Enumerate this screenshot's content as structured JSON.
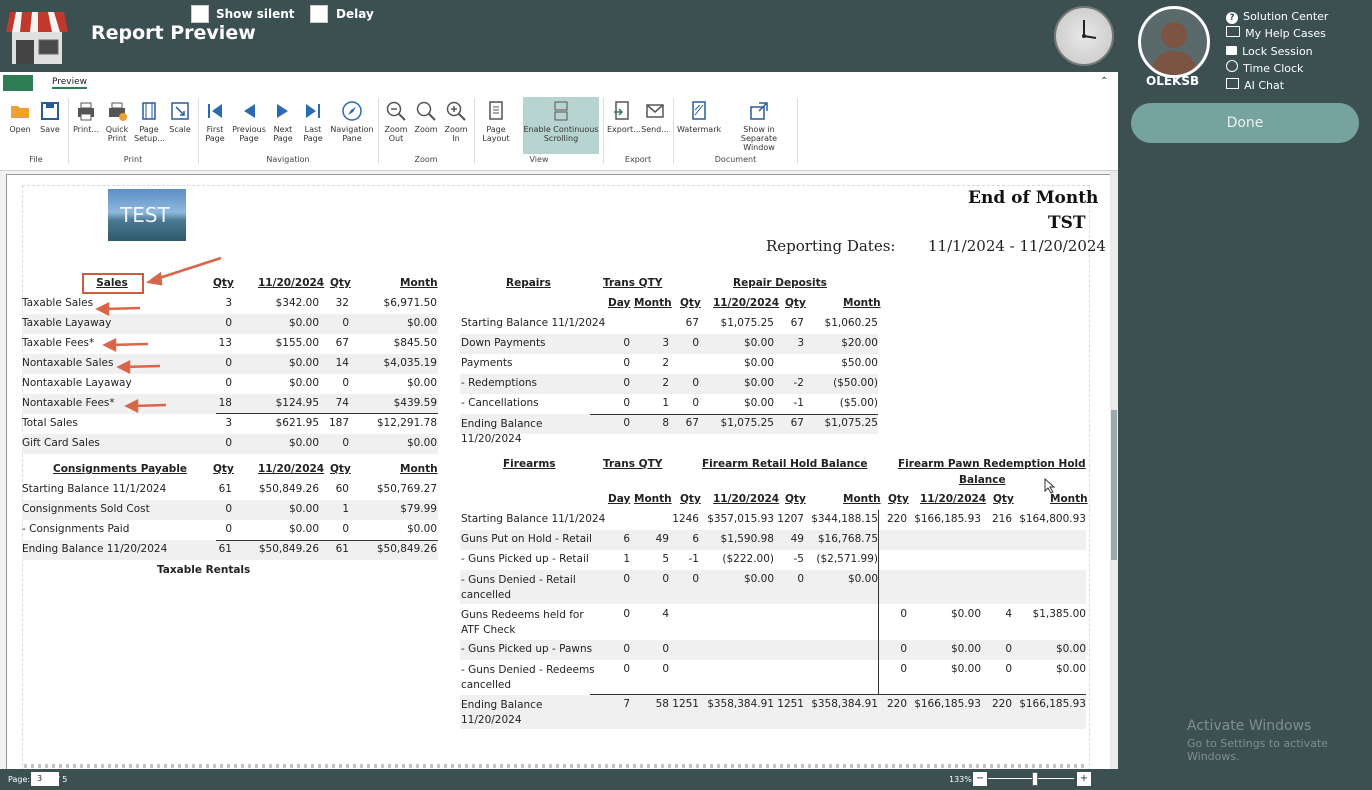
{
  "header": {
    "title": "Report Preview",
    "show_silent": "Show silent",
    "delay": "Delay"
  },
  "right_panel": {
    "links": [
      "Solution Center",
      "My Help Cases",
      "Lock Session",
      "Time Clock",
      "AI Chat"
    ],
    "username": "OLEKSB",
    "done": "Done",
    "activate_title": "Activate Windows",
    "activate_sub": "Go to Settings to activate Windows."
  },
  "ribbon": {
    "tab": "Preview",
    "buttons": {
      "open": "Open",
      "save": "Save",
      "print": "Print...",
      "quick_print": "Quick Print",
      "page_setup": "Page Setup...",
      "scale": "Scale",
      "first_page": "First Page",
      "previous_page": "Previous Page",
      "next_page": "Next Page",
      "last_page": "Last Page",
      "navigation_pane": "Navigation Pane",
      "zoom_out": "Zoom Out",
      "zoom": "Zoom",
      "zoom_in": "Zoom In",
      "page_layout": "Page Layout",
      "continuous": "Enable Continuous Scrolling",
      "export": "Export...",
      "send": "Send...",
      "watermark": "Watermark",
      "separate_window": "Show in Separate Window"
    },
    "groups": {
      "file": "File",
      "print": "Print",
      "navigation": "Navigation",
      "zoom": "Zoom",
      "view": "View",
      "export": "Export",
      "document": "Document"
    }
  },
  "statusbar": {
    "page_label": "Page:",
    "page": "3",
    "of": "/ 5",
    "zoom": "133%"
  },
  "report": {
    "logo_text": "TEST",
    "title": "End of Month",
    "store": "TST",
    "reporting_label": "Reporting Dates:",
    "reporting_range": "11/1/2024 - 11/20/2024",
    "sales": {
      "headers": [
        "Sales",
        "Qty",
        "11/20/2024",
        "Qty",
        "Month"
      ],
      "rows": [
        [
          "Taxable Sales",
          "3",
          "$342.00",
          "32",
          "$6,971.50"
        ],
        [
          "Taxable Layaway",
          "0",
          "$0.00",
          "0",
          "$0.00"
        ],
        [
          "Taxable Fees*",
          "13",
          "$155.00",
          "67",
          "$845.50"
        ],
        [
          "Nontaxable Sales",
          "0",
          "$0.00",
          "14",
          "$4,035.19"
        ],
        [
          "Nontaxable Layaway",
          "0",
          "$0.00",
          "0",
          "$0.00"
        ],
        [
          "Nontaxable Fees*",
          "18",
          "$124.95",
          "74",
          "$439.59"
        ],
        [
          "Total Sales",
          "3",
          "$621.95",
          "187",
          "$12,291.78"
        ],
        [
          "Gift Card Sales",
          "0",
          "$0.00",
          "0",
          "$0.00"
        ]
      ]
    },
    "consignments": {
      "headers": [
        "Consignments Payable",
        "Qty",
        "11/20/2024",
        "Qty",
        "Month"
      ],
      "rows": [
        [
          "Starting Balance 11/1/2024",
          "61",
          "$50,849.26",
          "60",
          "$50,769.27"
        ],
        [
          "Consignments Sold Cost",
          "0",
          "$0.00",
          "1",
          "$79.99"
        ],
        [
          "- Consignments Paid",
          "0",
          "$0.00",
          "0",
          "$0.00"
        ],
        [
          "Ending Balance 11/20/2024",
          "61",
          "$50,849.26",
          "61",
          "$50,849.26"
        ]
      ],
      "taxable_rentals": "Taxable Rentals"
    },
    "repairs": {
      "title": "Repairs",
      "trans_qty": "Trans QTY",
      "deposits": "Repair Deposits",
      "sub": [
        "Day",
        "Month",
        "Qty",
        "11/20/2024",
        "Qty",
        "Month"
      ],
      "rows": [
        [
          "Starting Balance 11/1/2024",
          "",
          "",
          "67",
          "$1,075.25",
          "67",
          "$1,060.25"
        ],
        [
          "Down Payments",
          "0",
          "3",
          "0",
          "$0.00",
          "3",
          "$20.00"
        ],
        [
          "Payments",
          "0",
          "2",
          "",
          "$0.00",
          "",
          "$50.00"
        ],
        [
          "- Redemptions",
          "0",
          "2",
          "0",
          "$0.00",
          "-2",
          "($50.00)"
        ],
        [
          "- Cancellations",
          "0",
          "1",
          "0",
          "$0.00",
          "-1",
          "($5.00)"
        ],
        [
          "Ending Balance\n11/20/2024",
          "0",
          "8",
          "67",
          "$1,075.25",
          "67",
          "$1,075.25"
        ]
      ]
    },
    "firearms": {
      "title": "Firearms",
      "trans_qty": "Trans QTY",
      "retail_hold": "Firearm Retail Hold Balance",
      "pawn_hold_1": "Firearm Pawn Redemption Hold",
      "pawn_hold_2": "Balance",
      "sub": [
        "Day",
        "Month",
        "Qty",
        "11/20/2024",
        "Qty",
        "Month",
        "Qty",
        "11/20/2024",
        "Qty",
        "Month"
      ],
      "rows": [
        [
          "Starting Balance 11/1/2024",
          "",
          "",
          "1246",
          "$357,015.93",
          "1207",
          "$344,188.15",
          "220",
          "$166,185.93",
          "216",
          "$164,800.93"
        ],
        [
          "Guns Put on Hold - Retail",
          "6",
          "49",
          "6",
          "$1,590.98",
          "49",
          "$16,768.75",
          "",
          "",
          "",
          ""
        ],
        [
          "- Guns Picked up - Retail",
          "1",
          "5",
          "-1",
          "($222.00)",
          "-5",
          "($2,571.99)",
          "",
          "",
          "",
          ""
        ],
        [
          "- Guns Denied - Retail\ncancelled",
          "0",
          "0",
          "0",
          "$0.00",
          "0",
          "$0.00",
          "",
          "",
          "",
          ""
        ],
        [
          "Guns Redeems held for\nATF Check",
          "0",
          "4",
          "",
          "",
          "",
          "",
          "0",
          "$0.00",
          "4",
          "$1,385.00"
        ],
        [
          "- Guns Picked up - Pawns",
          "0",
          "0",
          "",
          "",
          "",
          "",
          "0",
          "$0.00",
          "0",
          "$0.00"
        ],
        [
          "- Guns Denied - Redeems\ncancelled",
          "0",
          "0",
          "",
          "",
          "",
          "",
          "0",
          "$0.00",
          "0",
          "$0.00"
        ],
        [
          "Ending Balance\n11/20/2024",
          "7",
          "58",
          "1251",
          "$358,384.91",
          "1251",
          "$358,384.91",
          "220",
          "$166,185.93",
          "220",
          "$166,185.93"
        ]
      ]
    }
  }
}
